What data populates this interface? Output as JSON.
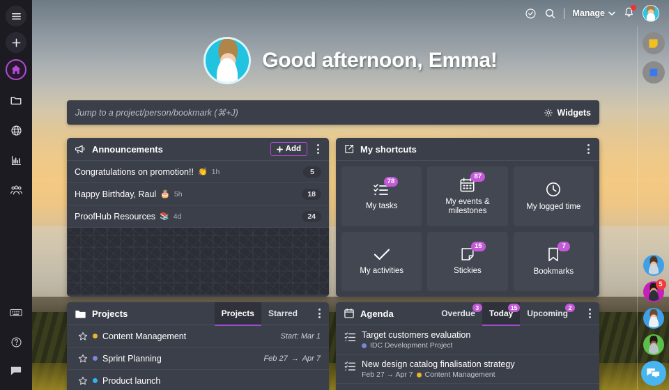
{
  "app": {
    "accent": "#b44ad6",
    "card_bg": "#3b3f49",
    "badge_color": "#c45ad8"
  },
  "sidebar": {
    "items": [
      {
        "name": "menu-icon",
        "label": "Menu"
      },
      {
        "name": "add-icon",
        "label": "Add"
      },
      {
        "name": "home-icon",
        "label": "Home"
      },
      {
        "name": "folder-icon",
        "label": "Projects"
      },
      {
        "name": "globe-icon",
        "label": "Everything"
      },
      {
        "name": "reports-icon",
        "label": "Reports"
      },
      {
        "name": "people-icon",
        "label": "People"
      }
    ],
    "bottom_items": [
      {
        "name": "keyboard-icon",
        "label": "Keyboard shortcuts"
      },
      {
        "name": "help-icon",
        "label": "Help"
      },
      {
        "name": "feedback-icon",
        "label": "Feedback"
      }
    ]
  },
  "topbar": {
    "timer_icon": "clock-check-icon",
    "search_icon": "search-icon",
    "manage_label": "Manage",
    "chevron_icon": "chevron-down-icon",
    "notifications_icon": "bell-icon",
    "avatar_name": "user-avatar"
  },
  "greeting": {
    "text": "Good afternoon, Emma!",
    "avatar_name": "greeting-avatar"
  },
  "jumpbar": {
    "placeholder": "Jump to a project/person/bookmark (⌘+J)",
    "widgets_label": "Widgets",
    "widgets_icon": "gear-icon"
  },
  "announcements": {
    "icon": "megaphone-icon",
    "title": "Announcements",
    "add_label": "Add",
    "rows": [
      {
        "title": "Congratulations on promotion!!",
        "emoji": "👏",
        "time": "1h",
        "count": "5"
      },
      {
        "title": "Happy Birthday, Raul",
        "emoji": "🎂",
        "time": "5h",
        "count": "18"
      },
      {
        "title": "ProofHub Resources",
        "emoji": "📚",
        "time": "4d",
        "count": "24"
      }
    ]
  },
  "shortcuts": {
    "icon": "share-box-icon",
    "title": "My shortcuts",
    "tiles": [
      {
        "label": "My tasks",
        "badge": "78",
        "icon": "checklist-icon"
      },
      {
        "label": "My events & milestones",
        "badge": "87",
        "icon": "calendar-icon"
      },
      {
        "label": "My logged time",
        "badge": "",
        "icon": "clock-icon"
      },
      {
        "label": "My activities",
        "badge": "",
        "icon": "check-icon"
      },
      {
        "label": "Stickies",
        "badge": "15",
        "icon": "sticky-note-icon"
      },
      {
        "label": "Bookmarks",
        "badge": "7",
        "icon": "bookmark-icon"
      }
    ]
  },
  "projects": {
    "icon": "folder-filled-icon",
    "title": "Projects",
    "tabs": [
      {
        "label": "Projects",
        "active": true,
        "badge": ""
      },
      {
        "label": "Starred",
        "active": false,
        "badge": ""
      }
    ],
    "rows": [
      {
        "name": "Content Management",
        "color": "#e8b62c",
        "dates": "Start: Mar 1",
        "range": false
      },
      {
        "name": "Sprint Planning",
        "color": "#7d86d8",
        "date_start": "Feb 27",
        "date_end": "Apr 7",
        "range": true
      },
      {
        "name": "Product launch",
        "color": "#34b3f1",
        "dates": "",
        "range": false
      }
    ]
  },
  "agenda": {
    "icon": "calendar-outline-icon",
    "title": "Agenda",
    "tabs": [
      {
        "label": "Overdue",
        "active": false,
        "badge": "3"
      },
      {
        "label": "Today",
        "active": true,
        "badge": "15"
      },
      {
        "label": "Upcoming",
        "active": false,
        "badge": "2"
      }
    ],
    "rows": [
      {
        "title": "Target customers evaluation",
        "sub_date": "",
        "project": "IDC Development Project",
        "color": "#7d86d8"
      },
      {
        "title": "New design catalog finalisation strategy",
        "sub_date": "Feb 27 → Apr 7",
        "project": "Content Management",
        "color": "#e8b62c"
      }
    ]
  },
  "rightrail": {
    "top_items": [
      {
        "name": "sticky-note-shortcut",
        "color": "#f4c01f"
      },
      {
        "name": "blue-square-shortcut",
        "color": "#3b78ef"
      }
    ],
    "avatars": [
      {
        "name": "avatar-1",
        "ring": "#3fa0e8",
        "badge": ""
      },
      {
        "name": "avatar-2",
        "ring": "#c421b8",
        "badge": "5"
      },
      {
        "name": "avatar-3",
        "ring": "#3fa0e8",
        "badge": ""
      },
      {
        "name": "avatar-4",
        "ring": "#5bbf4a",
        "badge": ""
      }
    ],
    "chat_icon": "chat-bubbles-icon"
  }
}
